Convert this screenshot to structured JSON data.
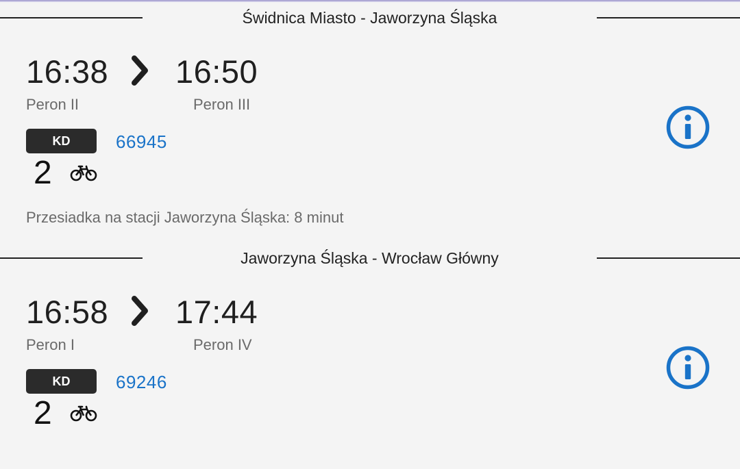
{
  "connections": [
    {
      "route": "Świdnica Miasto - Jaworzyna Śląska",
      "departure_time": "16:38",
      "arrival_time": "16:50",
      "departure_platform": "Peron II",
      "arrival_platform": "Peron III",
      "carrier": "KD",
      "train_number": "66945",
      "class": "2",
      "icons": [
        "chevron-right-icon",
        "bicycle-icon",
        "info-icon"
      ]
    },
    {
      "route": "Jaworzyna Śląska - Wrocław Główny",
      "departure_time": "16:58",
      "arrival_time": "17:44",
      "departure_platform": "Peron I",
      "arrival_platform": "Peron IV",
      "carrier": "KD",
      "train_number": "69246",
      "class": "2",
      "icons": [
        "chevron-right-icon",
        "bicycle-icon",
        "info-icon"
      ]
    }
  ],
  "transfer_note": "Przesiadka na stacji Jaworzyna Śląska: 8 minut",
  "colors": {
    "background": "#f4f4f4",
    "accent_blue": "#1a73c8",
    "badge_dark": "#2b2b2b",
    "text_dark": "#1f1f1f",
    "text_muted": "#6a6a6a"
  }
}
